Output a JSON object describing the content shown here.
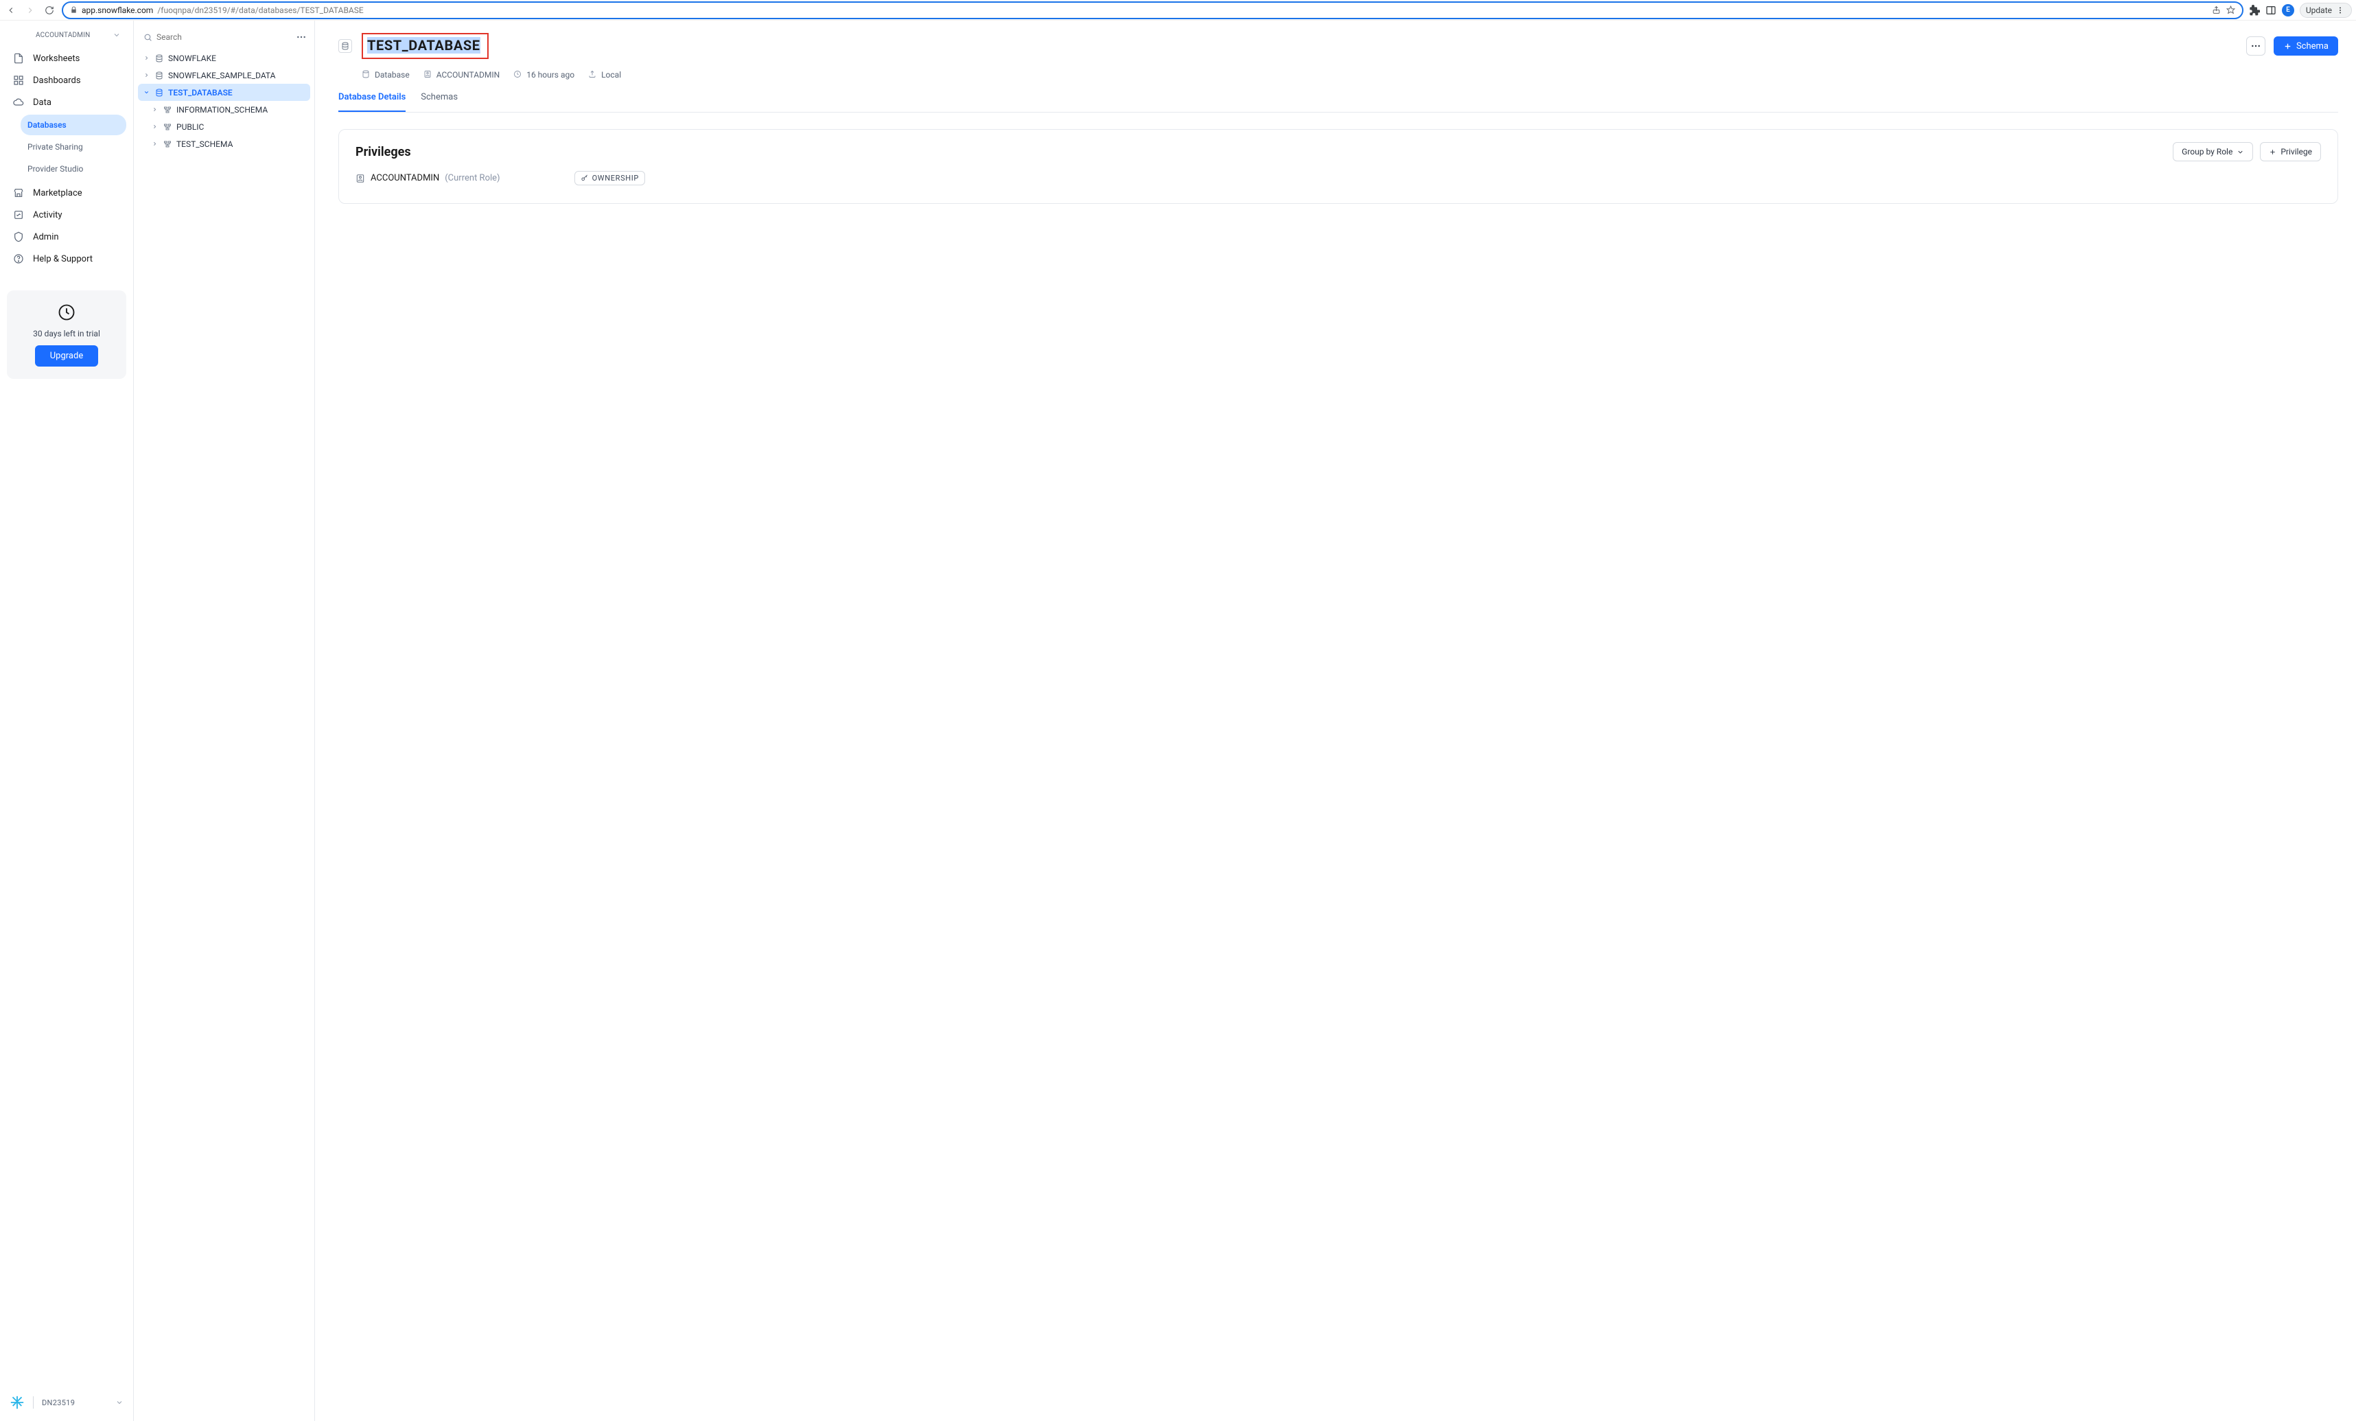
{
  "browser": {
    "url_host": "app.snowflake.com",
    "url_path": "/fuoqnpa/dn23519/#/data/databases/TEST_DATABASE",
    "avatar_letter": "E",
    "update_label": "Update"
  },
  "sidebar": {
    "account_role": "ACCOUNTADMIN",
    "items": {
      "worksheets": "Worksheets",
      "dashboards": "Dashboards",
      "data": "Data",
      "marketplace": "Marketplace",
      "activity": "Activity",
      "admin": "Admin",
      "help": "Help & Support"
    },
    "data_sub": {
      "databases": "Databases",
      "private_sharing": "Private Sharing",
      "provider_studio": "Provider Studio"
    },
    "trial": {
      "text": "30 days left in trial",
      "upgrade": "Upgrade"
    },
    "footer_id": "DN23519"
  },
  "tree": {
    "search_placeholder": "Search",
    "items": [
      {
        "name": "SNOWFLAKE",
        "kind": "db"
      },
      {
        "name": "SNOWFLAKE_SAMPLE_DATA",
        "kind": "db"
      },
      {
        "name": "TEST_DATABASE",
        "kind": "db",
        "active": true,
        "children": [
          {
            "name": "INFORMATION_SCHEMA",
            "kind": "schema"
          },
          {
            "name": "PUBLIC",
            "kind": "schema"
          },
          {
            "name": "TEST_SCHEMA",
            "kind": "schema"
          }
        ]
      }
    ]
  },
  "main": {
    "title": "TEST_DATABASE",
    "meta": {
      "type": "Database",
      "owner": "ACCOUNTADMIN",
      "age": "16 hours ago",
      "location": "Local"
    },
    "tabs": {
      "details": "Database Details",
      "schemas": "Schemas"
    },
    "schema_btn": "Schema",
    "privileges": {
      "title": "Privileges",
      "group_btn": "Group by Role",
      "add_btn": "Privilege",
      "rows": [
        {
          "role": "ACCOUNTADMIN",
          "note": "(Current Role)",
          "priv": "OWNERSHIP"
        }
      ]
    }
  }
}
